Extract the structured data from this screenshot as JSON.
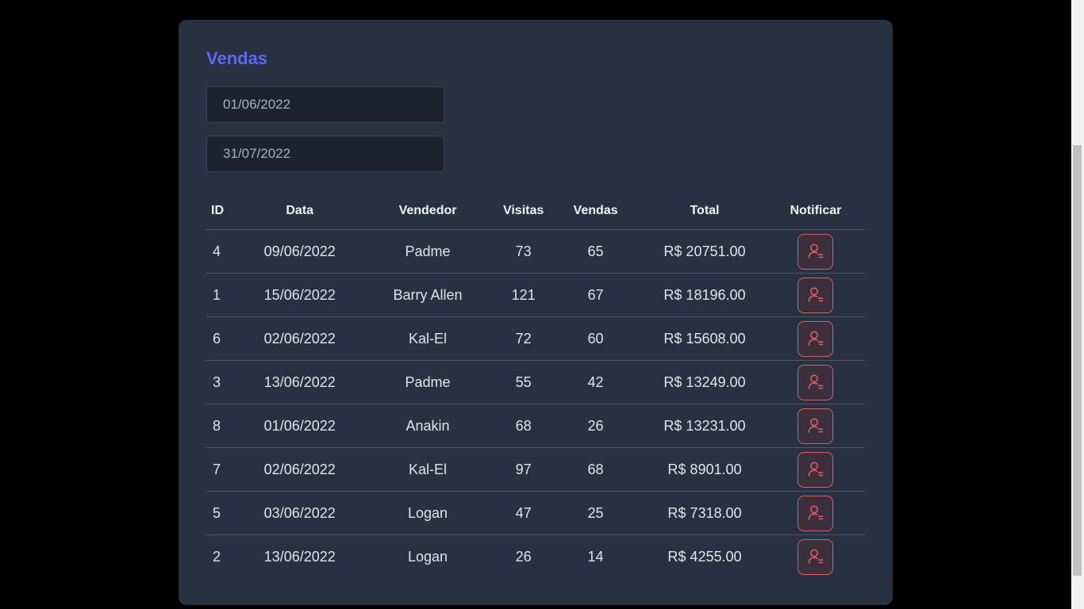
{
  "title": "Vendas",
  "filters": {
    "min_date": "01/06/2022",
    "max_date": "31/07/2022"
  },
  "table": {
    "headers": {
      "id": "ID",
      "data": "Data",
      "vendedor": "Vendedor",
      "visitas": "Visitas",
      "vendas": "Vendas",
      "total": "Total",
      "notificar": "Notificar"
    },
    "rows": [
      {
        "id": "4",
        "data": "09/06/2022",
        "vendedor": "Padme",
        "visitas": "73",
        "vendas": "65",
        "total": "R$ 20751.00"
      },
      {
        "id": "1",
        "data": "15/06/2022",
        "vendedor": "Barry Allen",
        "visitas": "121",
        "vendas": "67",
        "total": "R$ 18196.00"
      },
      {
        "id": "6",
        "data": "02/06/2022",
        "vendedor": "Kal-El",
        "visitas": "72",
        "vendas": "60",
        "total": "R$ 15608.00"
      },
      {
        "id": "3",
        "data": "13/06/2022",
        "vendedor": "Padme",
        "visitas": "55",
        "vendas": "42",
        "total": "R$ 13249.00"
      },
      {
        "id": "8",
        "data": "01/06/2022",
        "vendedor": "Anakin",
        "visitas": "68",
        "vendas": "26",
        "total": "R$ 13231.00"
      },
      {
        "id": "7",
        "data": "02/06/2022",
        "vendedor": "Kal-El",
        "visitas": "97",
        "vendas": "68",
        "total": "R$ 8901.00"
      },
      {
        "id": "5",
        "data": "03/06/2022",
        "vendedor": "Logan",
        "visitas": "47",
        "vendas": "25",
        "total": "R$ 7318.00"
      },
      {
        "id": "2",
        "data": "13/06/2022",
        "vendedor": "Logan",
        "visitas": "26",
        "vendas": "14",
        "total": "R$ 4255.00"
      }
    ]
  },
  "icons": {
    "notify_button": "user-notification-icon"
  },
  "colors": {
    "page_background": "#000000",
    "card_background": "#283141",
    "title_accent": "#5e68f0",
    "notify_accent": "#e05a66",
    "input_background": "#1c232f",
    "row_divider": "#4e5766"
  }
}
